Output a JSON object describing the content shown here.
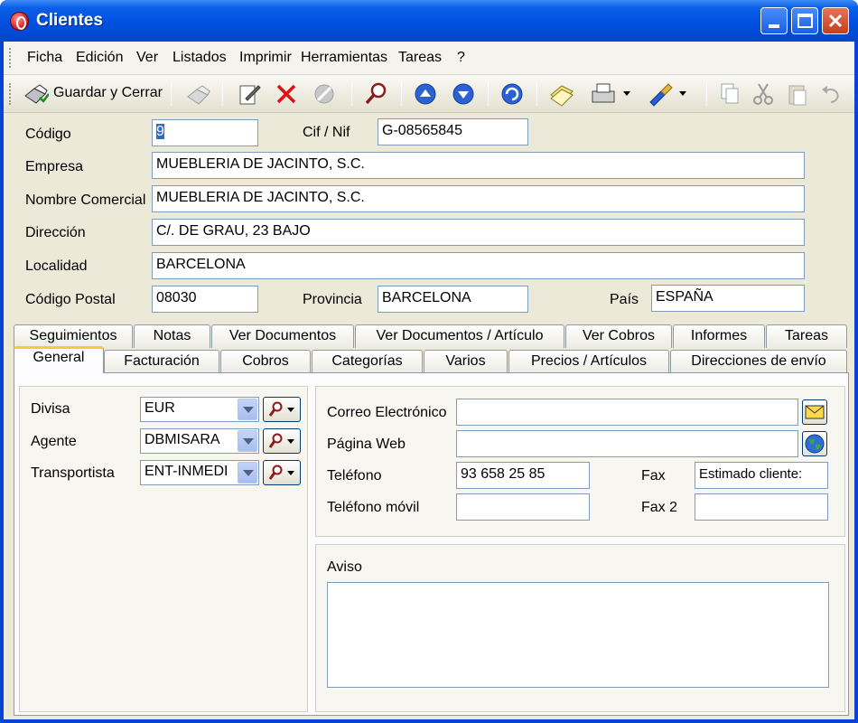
{
  "window": {
    "title": "Clientes"
  },
  "menu": [
    "Ficha",
    "Edición",
    "Ver",
    "Listados",
    "Imprimir",
    "Herramientas",
    "Tareas",
    "?"
  ],
  "toolbar": {
    "save_close": "Guardar y Cerrar"
  },
  "form": {
    "codigo": {
      "label": "Código",
      "value": "9"
    },
    "cif": {
      "label": "Cif / Nif",
      "value": "G-08565845"
    },
    "empresa": {
      "label": "Empresa",
      "value": "MUEBLERIA DE JACINTO, S.C."
    },
    "nombre_comercial": {
      "label": "Nombre Comercial",
      "value": "MUEBLERIA DE JACINTO, S.C."
    },
    "direccion": {
      "label": "Dirección",
      "value": "C/. DE GRAU, 23 BAJO"
    },
    "localidad": {
      "label": "Localidad",
      "value": "BARCELONA"
    },
    "codigo_postal": {
      "label": "Código Postal",
      "value": "08030"
    },
    "provincia": {
      "label": "Provincia",
      "value": "BARCELONA"
    },
    "pais": {
      "label": "País",
      "value": "ESPAÑA"
    }
  },
  "tabs_row1": [
    "Seguimientos",
    "Notas",
    "Ver Documentos",
    "Ver Documentos / Artículo",
    "Ver Cobros",
    "Informes",
    "Tareas"
  ],
  "tabs_row2": [
    "General",
    "Facturación",
    "Cobros",
    "Categorías",
    "Varios",
    "Precios / Artículos",
    "Direcciones de envío"
  ],
  "general": {
    "divisa": {
      "label": "Divisa",
      "value": "EUR"
    },
    "agente": {
      "label": "Agente",
      "value": "DBMISARA"
    },
    "transportista": {
      "label": "Transportista",
      "value": "ENT-INMEDI"
    },
    "correo": {
      "label": "Correo Electrónico",
      "value": ""
    },
    "web": {
      "label": "Página Web",
      "value": ""
    },
    "telefono": {
      "label": "Teléfono",
      "value": "93 658 25 85"
    },
    "movil": {
      "label": "Teléfono móvil",
      "value": ""
    },
    "fax": {
      "label": "Fax",
      "value": "Estimado cliente:"
    },
    "fax2": {
      "label": "Fax 2",
      "value": ""
    },
    "aviso": {
      "label": "Aviso",
      "value": ""
    }
  }
}
